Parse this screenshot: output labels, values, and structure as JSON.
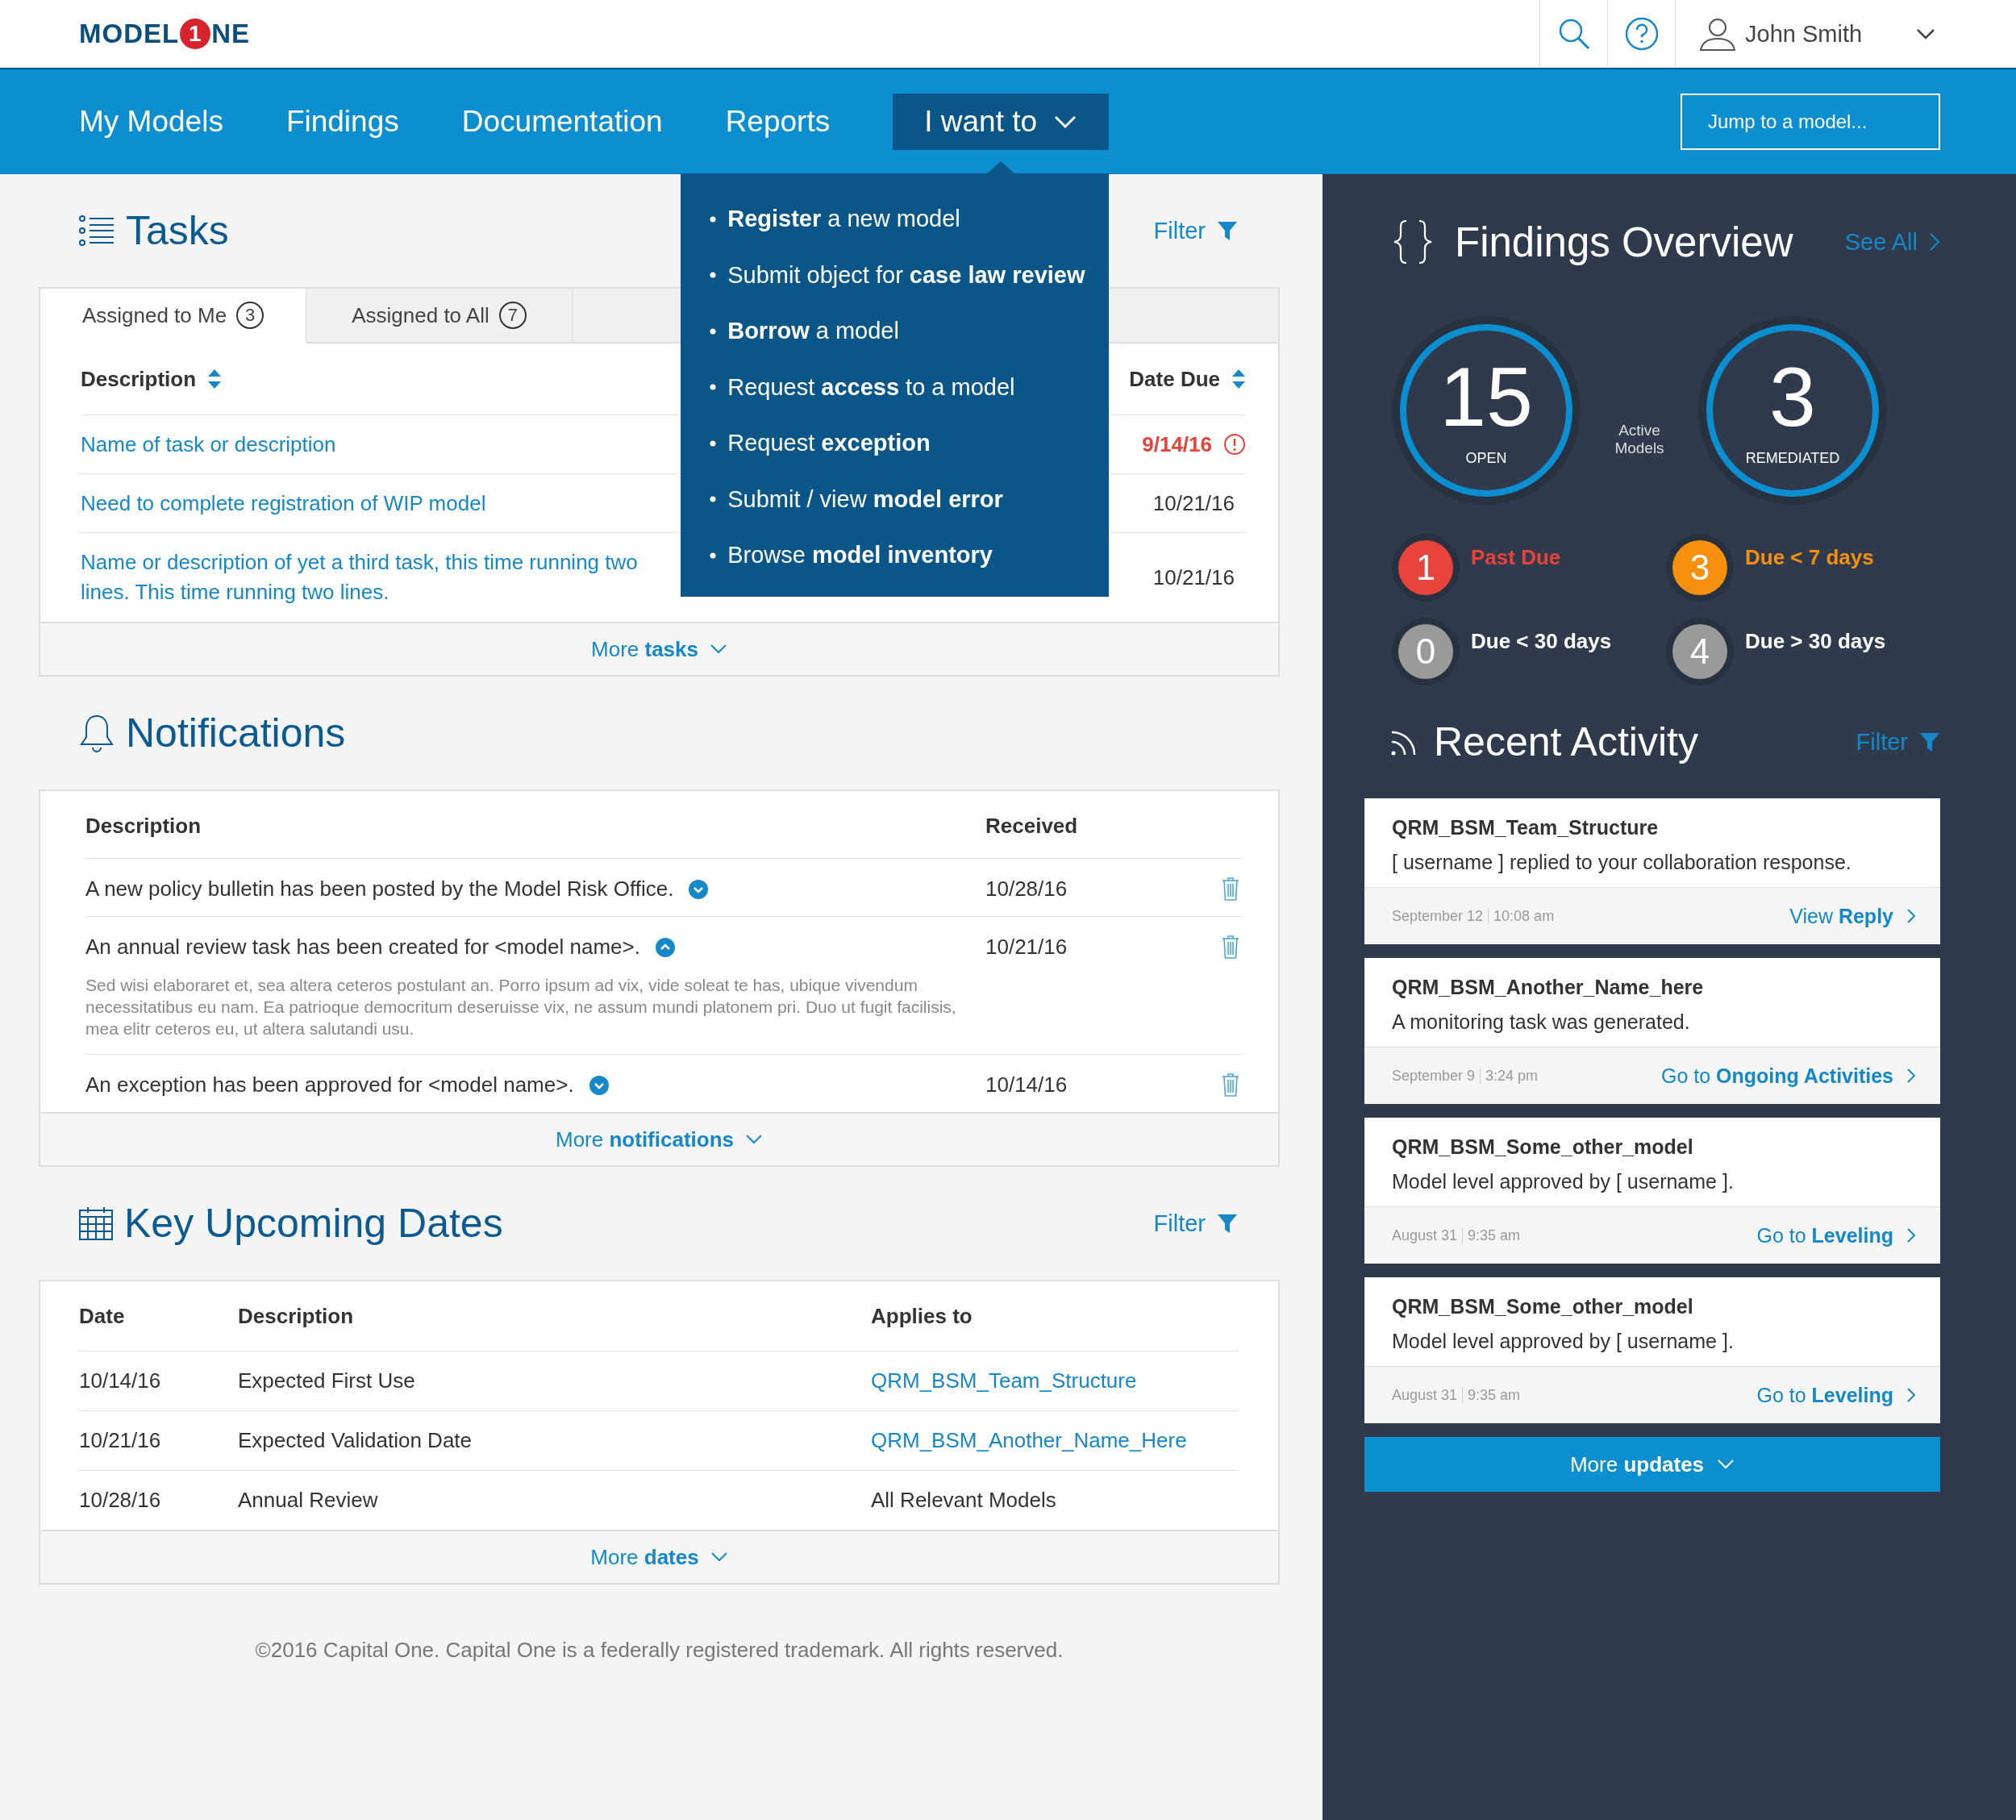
{
  "header": {
    "logo": {
      "before": "MODEL",
      "mark": "1",
      "after": "NE"
    },
    "user": "John Smith"
  },
  "nav": {
    "items": [
      "My Models",
      "Findings",
      "Documentation",
      "Reports"
    ],
    "menu": {
      "label": "I want to",
      "expanded": true,
      "items": [
        "**Register** a new model",
        "Submit object for **case law review**",
        "**Borrow** a model",
        "Request **access** to a model",
        "Request **exception**",
        "Submit / view **model error**",
        "Browse **model inventory**"
      ]
    },
    "jump": {
      "placeholder": "Jump to a model..."
    }
  },
  "tasks": {
    "title": "Tasks",
    "filter": "Filter",
    "tabs": [
      {
        "label": "Assigned to Me",
        "count": "3",
        "selected": true
      },
      {
        "label": "Assigned to All",
        "count": "7",
        "selected": false
      }
    ],
    "columns": [
      "Description",
      "Date Due"
    ],
    "rows": [
      {
        "description": "Name of task or description",
        "due": "9/14/16",
        "overdue": true
      },
      {
        "description": "Need to complete registration of WIP model",
        "due": "10/21/16",
        "overdue": false
      },
      {
        "description": "Name or description of yet a third task, this time running two lines. This time running two lines.",
        "due": "10/21/16",
        "overdue": false
      }
    ],
    "more": "More **tasks**"
  },
  "notifications": {
    "title": "Notifications",
    "columns": [
      "Description",
      "Received"
    ],
    "rows": [
      {
        "text": "A new policy bulletin has been posted by the Model Risk Office.",
        "received": "10/28/16",
        "expanded": false
      },
      {
        "text": "An annual review task has been created for <model name>.",
        "received": "10/21/16",
        "expanded": true,
        "detail": "Sed wisi elaboraret et, sea altera ceteros postulant an. Porro ipsum ad vix, vide soleat te has, ubique vivendum necessitatibus eu nam. Ea patrioque democritum deseruisse vix, ne assum mundi platonem pri. Duo ut fugit facilisis, mea elitr ceteros eu, ut altera salutandi usu."
      },
      {
        "text": "An exception has been approved for <model name>.",
        "received": "10/14/16",
        "expanded": false
      }
    ],
    "more": "More **notifications**"
  },
  "dates": {
    "title": "Key Upcoming Dates",
    "filter": "Filter",
    "columns": [
      "Date",
      "Description",
      "Applies to"
    ],
    "rows": [
      {
        "date": "10/14/16",
        "description": "Expected First Use",
        "applies_to": "QRM_BSM_Team_Structure",
        "link": true
      },
      {
        "date": "10/21/16",
        "description": "Expected Validation Date",
        "applies_to": "QRM_BSM_Another_Name_Here",
        "link": true
      },
      {
        "date": "10/28/16",
        "description": "Annual Review",
        "applies_to": "All Relevant Models",
        "link": false
      }
    ],
    "more": "More **dates**"
  },
  "footer": "©2016 Capital One. Capital One is a federally registered trademark. All rights reserved.",
  "findings": {
    "title": "Findings Overview",
    "see_all": "See All",
    "totals": [
      {
        "value": "15",
        "label": "OPEN"
      },
      {
        "value": "3",
        "label": "REMEDIATED"
      }
    ],
    "center_label": "Active Models",
    "buckets": [
      {
        "count": "1",
        "label": "Past Due",
        "color": "#e8433a",
        "urgent": true
      },
      {
        "count": "3",
        "label": "Due < 7 days",
        "color": "#f7900f",
        "urgent": true
      },
      {
        "count": "0",
        "label": "Due < 30 days",
        "color": "#9a9a9a",
        "urgent": false
      },
      {
        "count": "4",
        "label": "Due > 30 days",
        "color": "#9a9a9a",
        "urgent": false
      }
    ]
  },
  "activity": {
    "title": "Recent Activity",
    "filter": "Filter",
    "items": [
      {
        "model": "QRM_BSM_Team_Structure",
        "message": "[ username ] replied to your collaboration response.",
        "date": "September 12",
        "time": "10:08 am",
        "action": "View **Reply**"
      },
      {
        "model": "QRM_BSM_Another_Name_here",
        "message": "A monitoring task was generated.",
        "date": "September 9",
        "time": "3:24 pm",
        "action": "Go to **Ongoing Activities**"
      },
      {
        "model": "QRM_BSM_Some_other_model",
        "message": "Model level approved by [ username ].",
        "date": "August 31",
        "time": "9:35 am",
        "action": "Go to **Leveling**"
      },
      {
        "model": "QRM_BSM_Some_other_model",
        "message": "Model level approved by [ username ].",
        "date": "August 31",
        "time": "9:35 am",
        "action": "Go to **Leveling**"
      }
    ],
    "more": "More **updates**"
  }
}
